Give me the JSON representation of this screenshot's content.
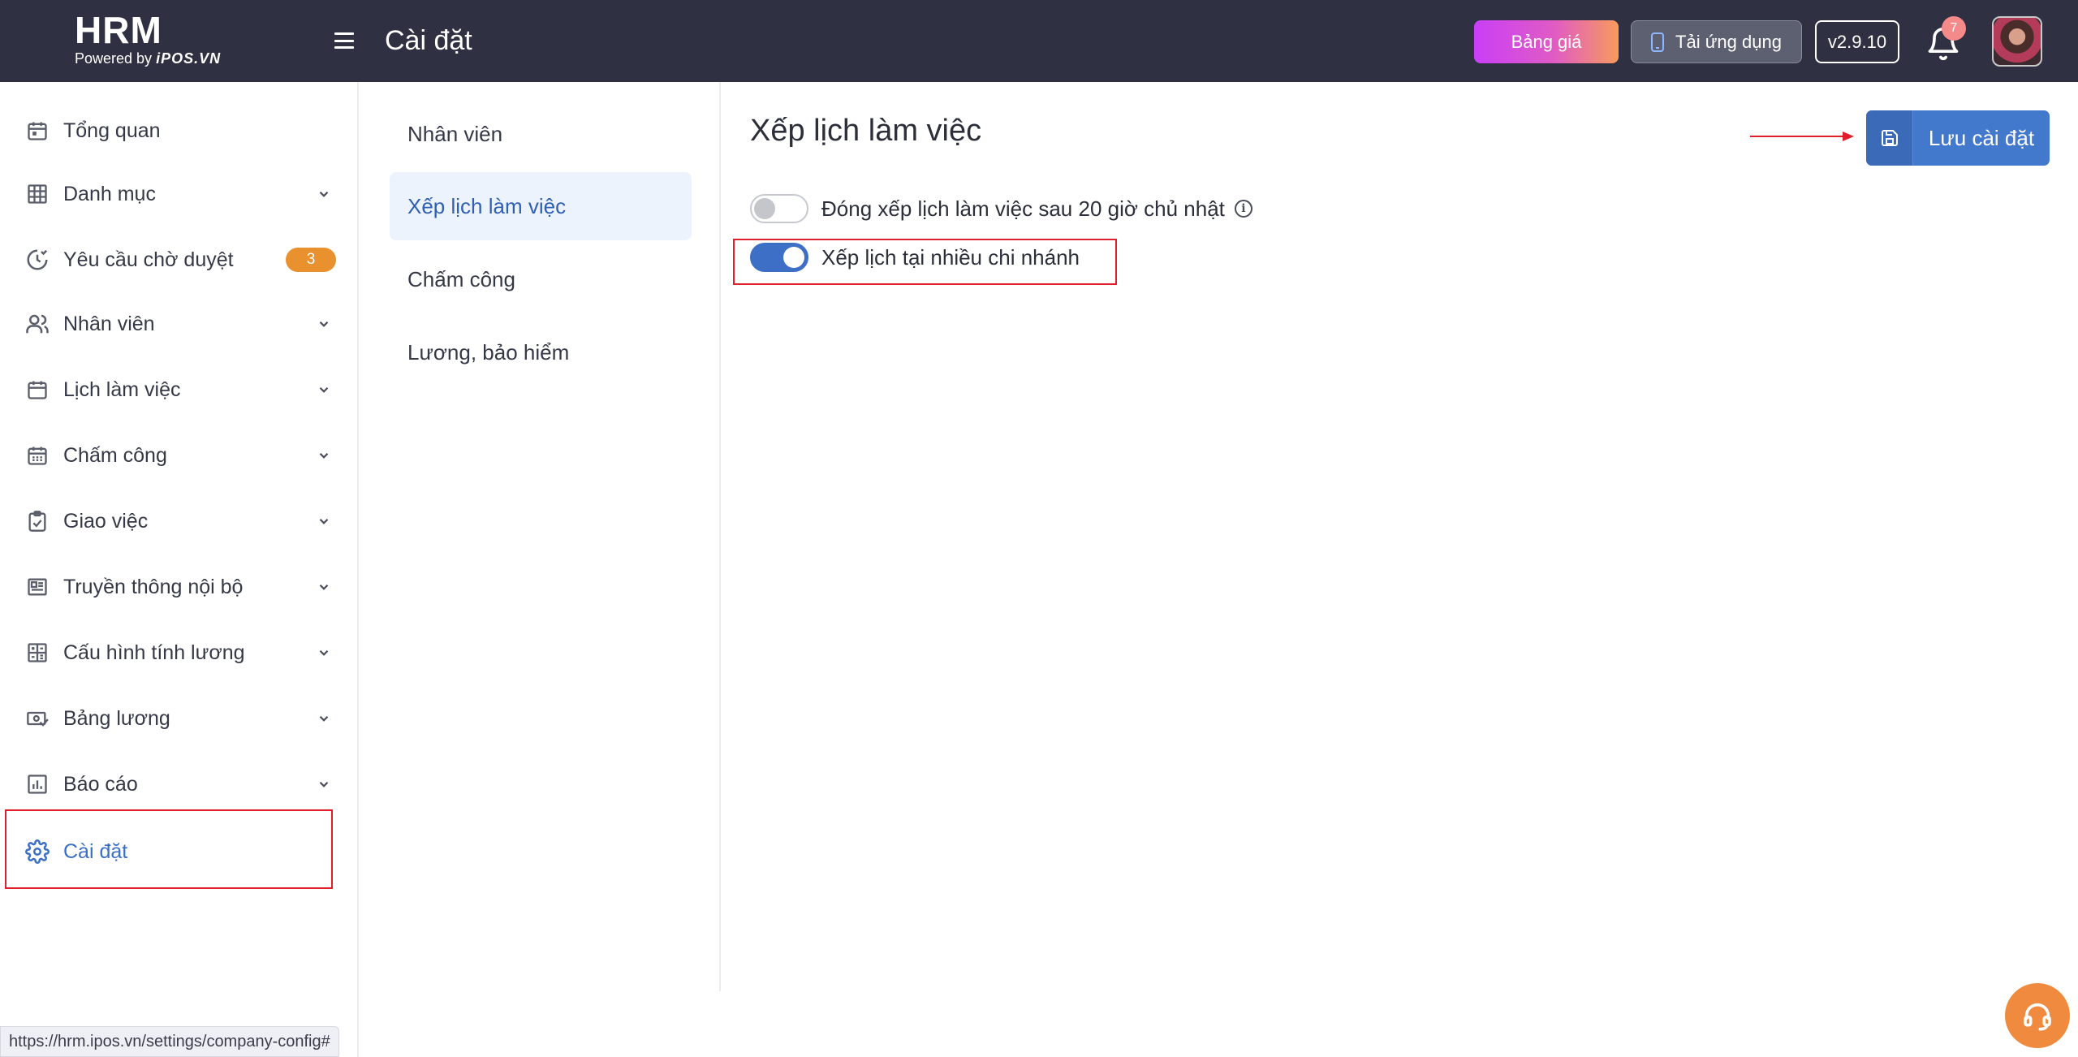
{
  "header": {
    "logo_main": "HRM",
    "logo_powered": "Powered by",
    "logo_brand": "iPOS.VN",
    "page_title": "Cài đặt",
    "pricing_button": "Bảng giá",
    "app_button": "Tải ứng dụng",
    "version": "v2.9.10",
    "notification_count": "7"
  },
  "sidebar": {
    "items": [
      {
        "label": "Tổng quan",
        "icon": "calendar-icon"
      },
      {
        "label": "Danh mục",
        "icon": "grid-icon"
      },
      {
        "label": "Yêu cầu chờ duyệt",
        "icon": "clock-check-icon",
        "badge": "3"
      },
      {
        "label": "Nhân viên",
        "icon": "users-icon"
      },
      {
        "label": "Lịch làm việc",
        "icon": "calendar-icon"
      },
      {
        "label": "Chấm công",
        "icon": "calendar-grid-icon"
      },
      {
        "label": "Giao việc",
        "icon": "clipboard-check-icon"
      },
      {
        "label": "Truyền thông nội bộ",
        "icon": "newspaper-icon"
      },
      {
        "label": "Cấu hình tính lương",
        "icon": "calculator-icon"
      },
      {
        "label": "Bảng lương",
        "icon": "money-check-icon"
      },
      {
        "label": "Báo cáo",
        "icon": "bar-chart-icon"
      },
      {
        "label": "Cài đặt",
        "icon": "gear-icon",
        "active": true
      }
    ]
  },
  "settings_menu": {
    "items": [
      {
        "label": "Nhân viên"
      },
      {
        "label": "Xếp lịch làm việc",
        "active": true
      },
      {
        "label": "Chấm công"
      },
      {
        "label": "Lương, bảo hiểm"
      }
    ]
  },
  "main": {
    "title": "Xếp lịch làm việc",
    "save_button": "Lưu cài đặt",
    "toggles": [
      {
        "label": "Đóng xếp lịch làm việc sau 20 giờ chủ nhật",
        "on": false
      },
      {
        "label": "Xếp lịch tại nhiều chi nhánh",
        "on": true
      }
    ]
  },
  "status_url": "https://hrm.ipos.vn/settings/company-config#",
  "colors": {
    "header_bg": "#2f3142",
    "accent_blue": "#4379cc",
    "badge_orange": "#e8912e",
    "highlight_red": "#e01e2b",
    "support_orange": "#f08a3e"
  }
}
